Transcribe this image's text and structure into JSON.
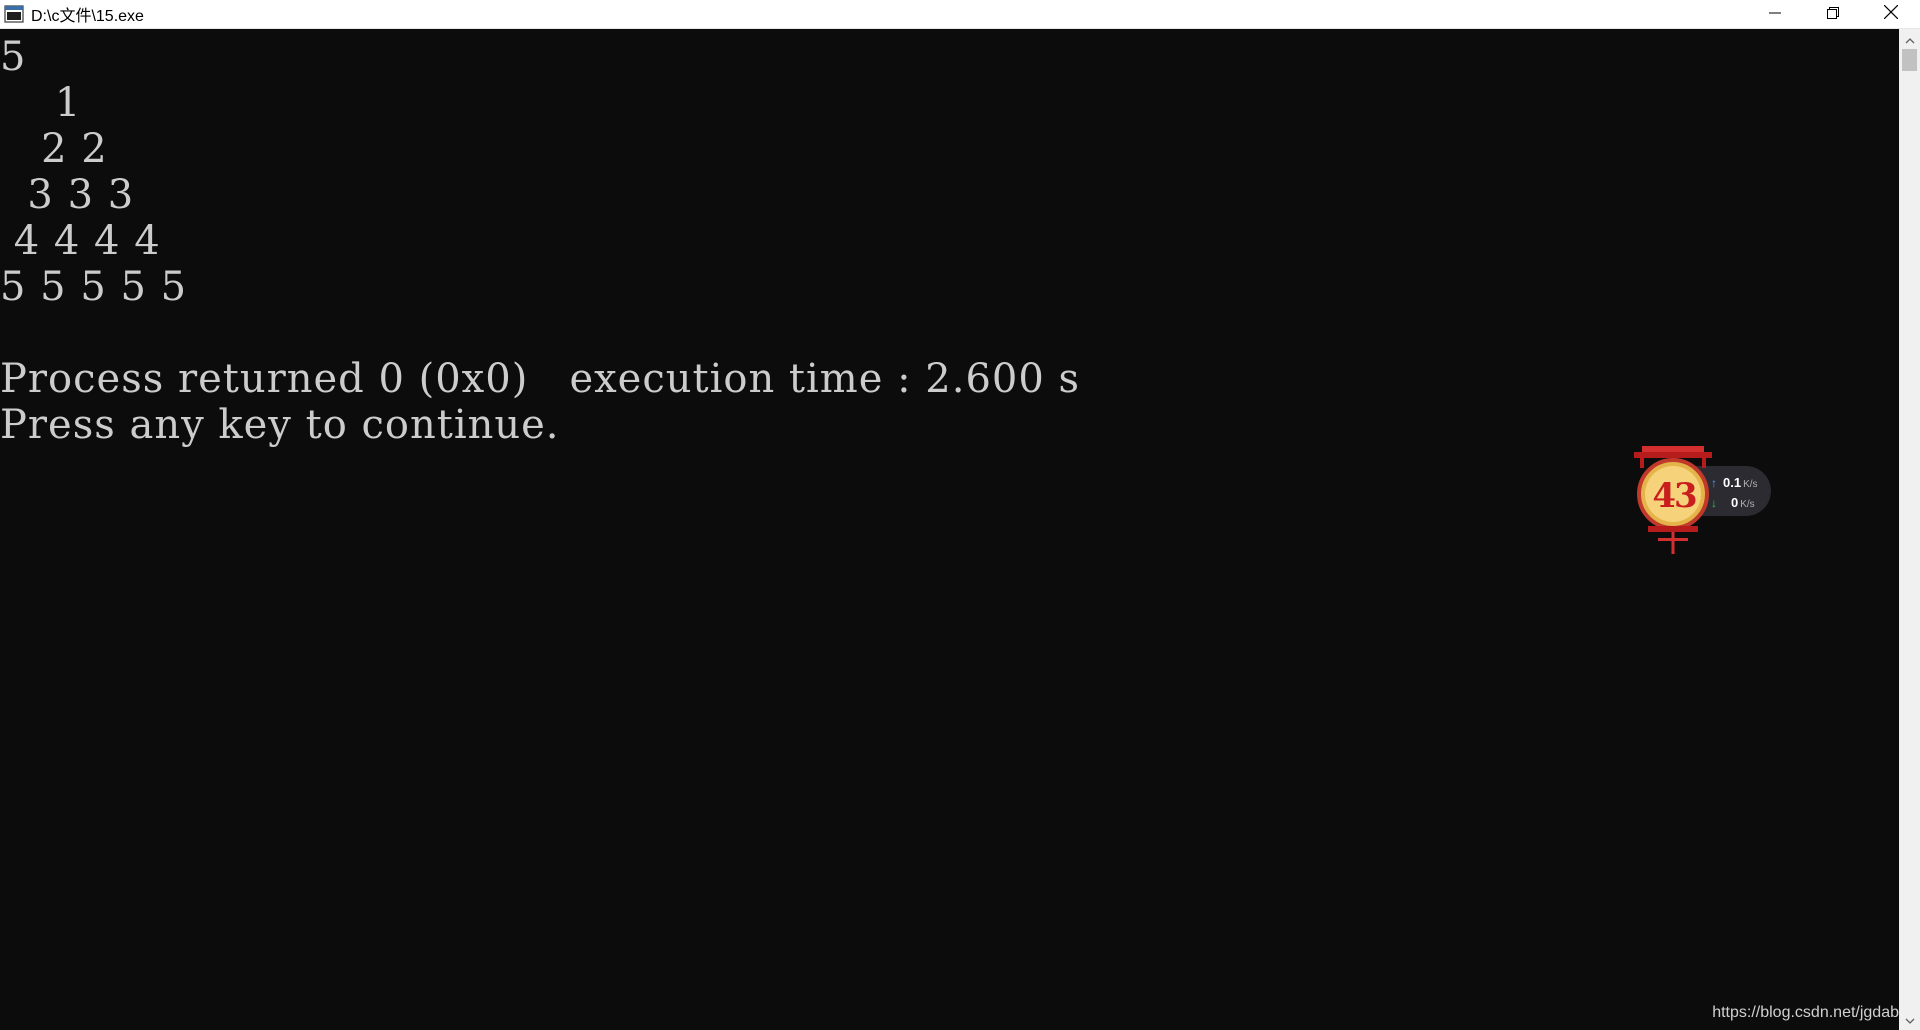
{
  "window": {
    "title": "D:\\c文件\\15.exe",
    "controls": {
      "minimize": "minimize-icon",
      "restore": "restore-icon",
      "close": "close-icon"
    }
  },
  "console": {
    "lines": [
      "5",
      "    1",
      "   2 2",
      "  3 3 3",
      " 4 4 4 4",
      "5 5 5 5 5",
      "",
      "Process returned 0 (0x0)   execution time : 2.600 s",
      "Press any key to continue."
    ],
    "text_color": "#cccccc",
    "background": "#0c0c0c"
  },
  "net_widget": {
    "badge": "43",
    "upload": {
      "value": "0.1",
      "unit": "K/s"
    },
    "download": {
      "value": "0",
      "unit": "K/s"
    },
    "upload_color": "#4aa3ff",
    "download_color": "#2ecc40"
  },
  "watermark": "https://blog.csdn.net/jgdab"
}
